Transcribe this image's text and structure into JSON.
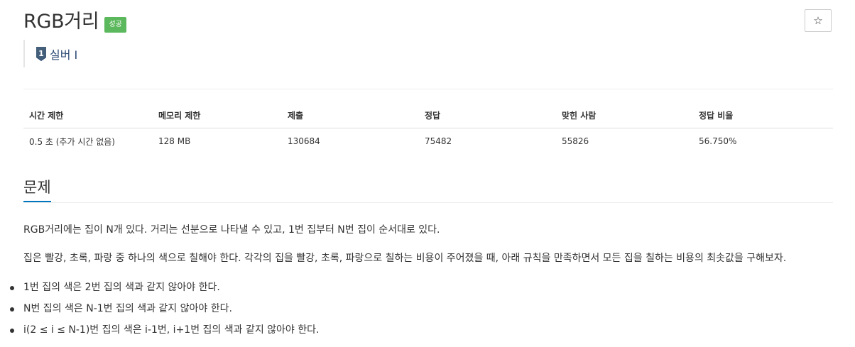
{
  "problem": {
    "title": "RGB거리",
    "result_badge": "성공",
    "favorite_icon": "star-icon",
    "tier_label": "실버 I",
    "tier_icon": "silver-tier-1-icon"
  },
  "info_table": {
    "headers": [
      "시간 제한",
      "메모리 제한",
      "제출",
      "정답",
      "맞힌 사람",
      "정답 비율"
    ],
    "row": [
      "0.5 초 (추가 시간 없음)",
      "128 MB",
      "130684",
      "75482",
      "55826",
      "56.750%"
    ]
  },
  "section": {
    "title": "문제",
    "paragraphs": [
      "RGB거리에는 집이 N개 있다. 거리는 선분으로 나타낼 수 있고, 1번 집부터 N번 집이 순서대로 있다.",
      "집은 빨강, 초록, 파랑 중 하나의 색으로 칠해야 한다. 각각의 집을 빨강, 초록, 파랑으로 칠하는 비용이 주어졌을 때, 아래 규칙을 만족하면서 모든 집을 칠하는 비용의 최솟값을 구해보자."
    ],
    "rules": [
      "1번 집의 색은 2번 집의 색과 같지 않아야 한다.",
      "N번 집의 색은 N-1번 집의 색과 같지 않아야 한다.",
      "i(2 ≤ i ≤ N-1)번 집의 색은 i-1번, i+1번 집의 색과 같지 않아야 한다."
    ]
  },
  "colors": {
    "badge_success": "#5cb85c",
    "tier_silver": "#2c4a73",
    "section_underline": "#0076c0"
  }
}
